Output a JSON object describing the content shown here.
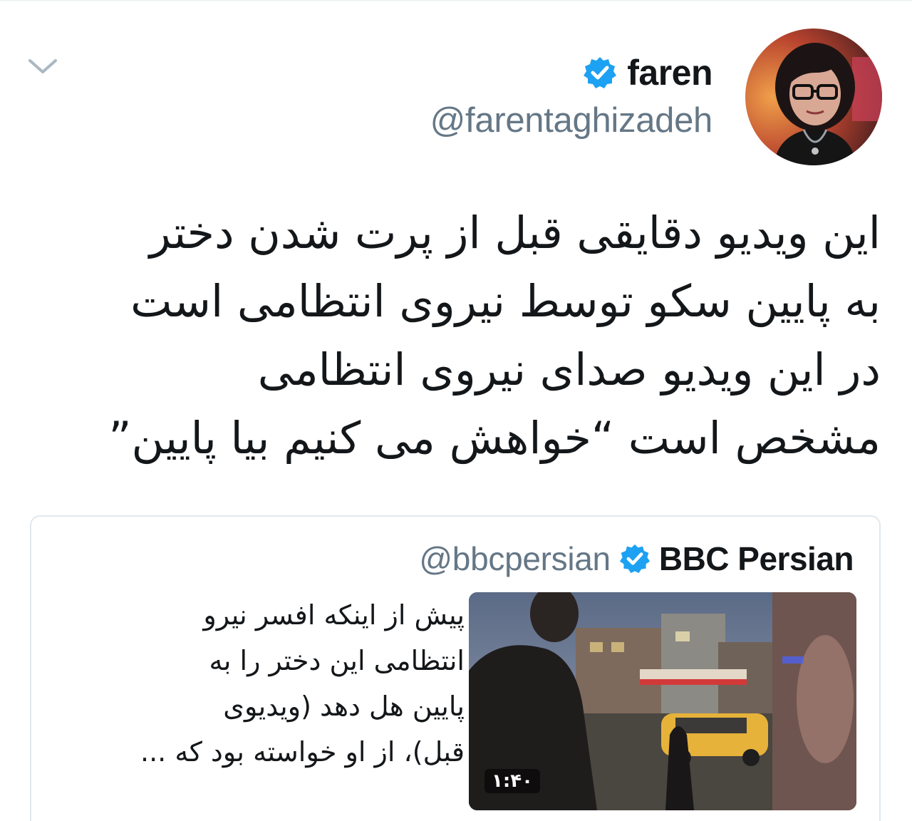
{
  "colors": {
    "text_primary": "#14171a",
    "text_secondary": "#657786",
    "verified_blue": "#1da1f2",
    "card_border": "#e1e8ed"
  },
  "header": {
    "caret_icon": "chevron-down-icon",
    "display_name": "faren",
    "verified_icon": "verified-badge-icon",
    "handle": "@farentaghizadeh"
  },
  "tweet": {
    "lines": [
      "این ویدیو دقایقی قبل از پرت شدن دختر",
      "به پایین سکو توسط نیروی انتظامی است",
      "در این ویدیو صدای نیروی انتظامی",
      "مشخص است “خواهش می کنیم بیا پایین”"
    ]
  },
  "quoted_tweet": {
    "name": "BBC Persian",
    "verified_icon": "verified-badge-icon",
    "handle": "@bbcpersian",
    "text_lines": [
      "پیش از اینکه افسر نیرو",
      "انتظامی این دختر را به",
      "پایین هل دهد (ویدیوی",
      "قبل)، از او خواسته بود که ..."
    ],
    "video": {
      "duration": "۱:۴۰"
    }
  }
}
